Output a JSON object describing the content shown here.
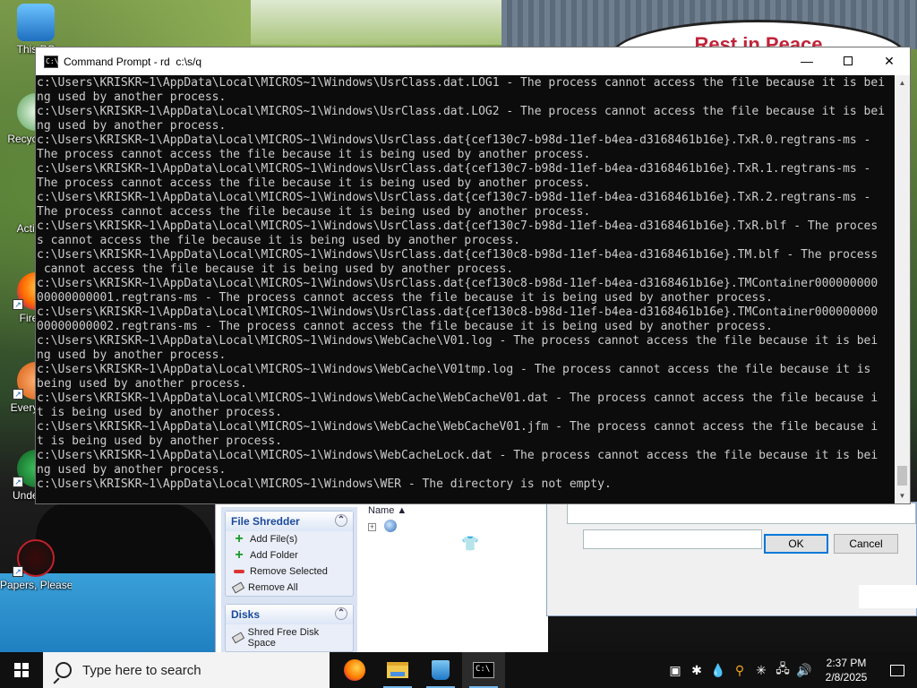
{
  "desktop": {
    "sign_text": "Rest in Peace",
    "icons": [
      {
        "label": "This PC"
      },
      {
        "label": "Recycle Bin"
      },
      {
        "label": "Activate"
      },
      {
        "label": "Firefox"
      },
      {
        "label": "Everything"
      },
      {
        "label": "Undertale"
      },
      {
        "label": "Papers, Please"
      }
    ]
  },
  "cmd": {
    "title": "Command Prompt - rd  c:\\s/q",
    "lines": [
      "c:\\Users\\KRISKR~1\\AppData\\Local\\MICROS~1\\Windows\\UsrClass.dat.LOG1 - The process cannot access the file because it is bei",
      "ng used by another process.",
      "c:\\Users\\KRISKR~1\\AppData\\Local\\MICROS~1\\Windows\\UsrClass.dat.LOG2 - The process cannot access the file because it is bei",
      "ng used by another process.",
      "c:\\Users\\KRISKR~1\\AppData\\Local\\MICROS~1\\Windows\\UsrClass.dat{cef130c7-b98d-11ef-b4ea-d3168461b16e}.TxR.0.regtrans-ms -",
      "The process cannot access the file because it is being used by another process.",
      "c:\\Users\\KRISKR~1\\AppData\\Local\\MICROS~1\\Windows\\UsrClass.dat{cef130c7-b98d-11ef-b4ea-d3168461b16e}.TxR.1.regtrans-ms -",
      "The process cannot access the file because it is being used by another process.",
      "c:\\Users\\KRISKR~1\\AppData\\Local\\MICROS~1\\Windows\\UsrClass.dat{cef130c7-b98d-11ef-b4ea-d3168461b16e}.TxR.2.regtrans-ms -",
      "The process cannot access the file because it is being used by another process.",
      "c:\\Users\\KRISKR~1\\AppData\\Local\\MICROS~1\\Windows\\UsrClass.dat{cef130c7-b98d-11ef-b4ea-d3168461b16e}.TxR.blf - The proces",
      "s cannot access the file because it is being used by another process.",
      "c:\\Users\\KRISKR~1\\AppData\\Local\\MICROS~1\\Windows\\UsrClass.dat{cef130c8-b98d-11ef-b4ea-d3168461b16e}.TM.blf - The process",
      " cannot access the file because it is being used by another process.",
      "c:\\Users\\KRISKR~1\\AppData\\Local\\MICROS~1\\Windows\\UsrClass.dat{cef130c8-b98d-11ef-b4ea-d3168461b16e}.TMContainer000000000",
      "00000000001.regtrans-ms - The process cannot access the file because it is being used by another process.",
      "c:\\Users\\KRISKR~1\\AppData\\Local\\MICROS~1\\Windows\\UsrClass.dat{cef130c8-b98d-11ef-b4ea-d3168461b16e}.TMContainer000000000",
      "00000000002.regtrans-ms - The process cannot access the file because it is being used by another process.",
      "c:\\Users\\KRISKR~1\\AppData\\Local\\MICROS~1\\Windows\\WebCache\\V01.log - The process cannot access the file because it is bei",
      "ng used by another process.",
      "c:\\Users\\KRISKR~1\\AppData\\Local\\MICROS~1\\Windows\\WebCache\\V01tmp.log - The process cannot access the file because it is",
      "being used by another process.",
      "c:\\Users\\KRISKR~1\\AppData\\Local\\MICROS~1\\Windows\\WebCache\\WebCacheV01.dat - The process cannot access the file because i",
      "t is being used by another process.",
      "c:\\Users\\KRISKR~1\\AppData\\Local\\MICROS~1\\Windows\\WebCache\\WebCacheV01.jfm - The process cannot access the file because i",
      "t is being used by another process.",
      "c:\\Users\\KRISKR~1\\AppData\\Local\\MICROS~1\\Windows\\WebCacheLock.dat - The process cannot access the file because it is bei",
      "ng used by another process.",
      "c:\\Users\\KRISKR~1\\AppData\\Local\\MICROS~1\\Windows\\WER - The directory is not empty."
    ]
  },
  "shredder": {
    "panel1_title": "File Shredder",
    "add_files": "Add File(s)",
    "add_folder": "Add Folder",
    "remove_selected": "Remove Selected",
    "remove_all": "Remove All",
    "panel2_title": "Disks",
    "shred_free": "Shred Free Disk Space",
    "name_col": "Name"
  },
  "dialog": {
    "ok": "OK",
    "cancel": "Cancel"
  },
  "taskbar": {
    "search_placeholder": "Type here to search",
    "time": "2:37 PM",
    "date": "2/8/2025"
  }
}
